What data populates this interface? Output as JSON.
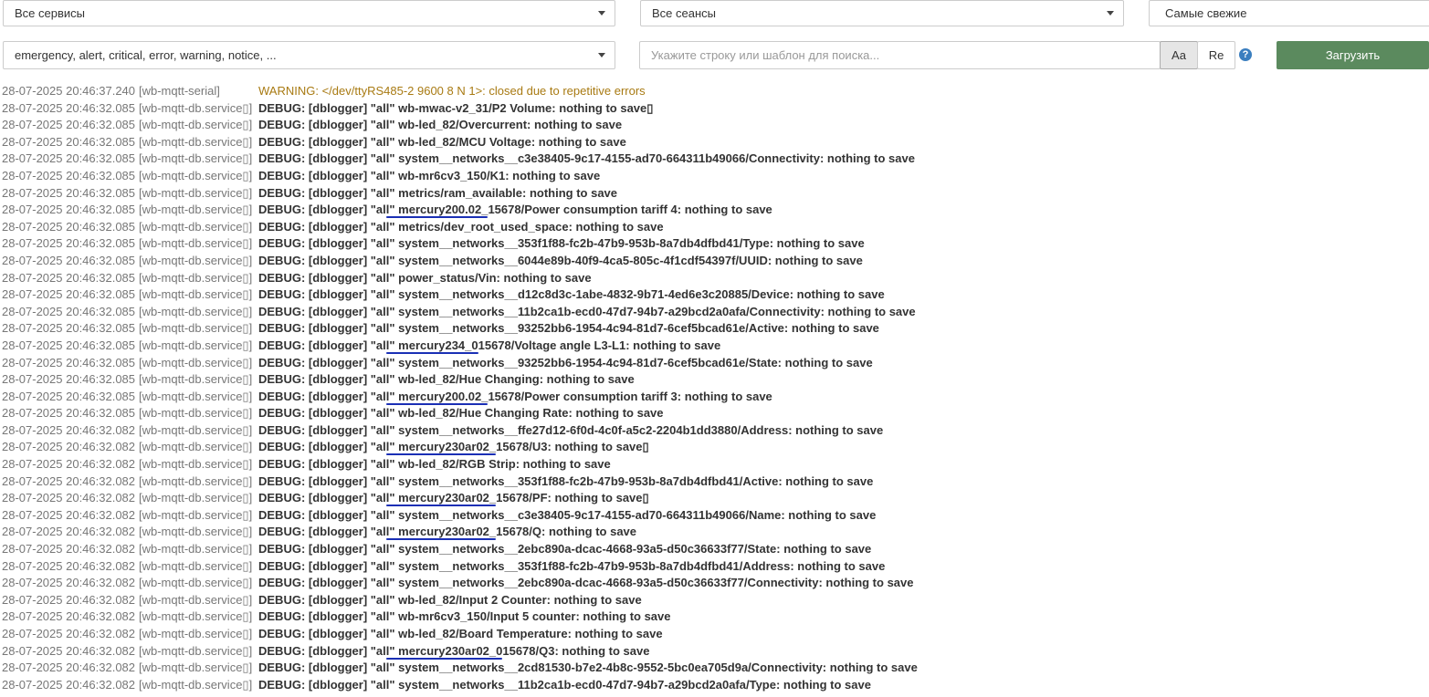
{
  "toolbar": {
    "services_select": "Все сервисы",
    "sessions_select": "Все сеансы",
    "order_select": "Самые свежие",
    "levels_select": "emergency, alert, critical, error, warning, notice, ...",
    "search_placeholder": "Укажите строку или шаблон для поиска...",
    "case_toggle": "Aa",
    "regex_toggle": "Re",
    "help_icon": "?",
    "load_button": "Загрузить"
  },
  "log_rows": [
    {
      "ts": "28-07-2025 20:46:37.240",
      "svc": "[wb-mqtt-serial]",
      "msg": "WARNING: </dev/ttyRS485-2 9600 8 N 1>: closed due to repetitive errors",
      "level": "warning"
    },
    {
      "ts": "28-07-2025 20:46:32.085",
      "svc": "[wb-mqtt-db.service▯]",
      "msg": "DEBUG: [dblogger] \"all\" wb-mwac-v2_31/P2 Volume: nothing to save▯",
      "level": "debug"
    },
    {
      "ts": "28-07-2025 20:46:32.085",
      "svc": "[wb-mqtt-db.service▯]",
      "msg": "DEBUG: [dblogger] \"all\" wb-led_82/Overcurrent: nothing to save",
      "level": "debug"
    },
    {
      "ts": "28-07-2025 20:46:32.085",
      "svc": "[wb-mqtt-db.service▯]",
      "msg": "DEBUG: [dblogger] \"all\" wb-led_82/MCU Voltage: nothing to save",
      "level": "debug"
    },
    {
      "ts": "28-07-2025 20:46:32.085",
      "svc": "[wb-mqtt-db.service▯]",
      "msg": "DEBUG: [dblogger] \"all\" system__networks__c3e38405-9c17-4155-ad70-664311b49066/Connectivity: nothing to save",
      "level": "debug"
    },
    {
      "ts": "28-07-2025 20:46:32.085",
      "svc": "[wb-mqtt-db.service▯]",
      "msg": "DEBUG: [dblogger] \"all\" wb-mr6cv3_150/K1: nothing to save",
      "level": "debug"
    },
    {
      "ts": "28-07-2025 20:46:32.085",
      "svc": "[wb-mqtt-db.service▯]",
      "msg": "DEBUG: [dblogger] \"all\" metrics/ram_available: nothing to save",
      "level": "debug"
    },
    {
      "ts": "28-07-2025 20:46:32.085",
      "svc": "[wb-mqtt-db.service▯]",
      "msg": "DEBUG: [dblogger] \"all\" mercury200.02_15678/Power consumption tariff 4: nothing to save",
      "level": "debug",
      "underline": true
    },
    {
      "ts": "28-07-2025 20:46:32.085",
      "svc": "[wb-mqtt-db.service▯]",
      "msg": "DEBUG: [dblogger] \"all\" metrics/dev_root_used_space: nothing to save",
      "level": "debug"
    },
    {
      "ts": "28-07-2025 20:46:32.085",
      "svc": "[wb-mqtt-db.service▯]",
      "msg": "DEBUG: [dblogger] \"all\" system__networks__353f1f88-fc2b-47b9-953b-8a7db4dfbd41/Type: nothing to save",
      "level": "debug"
    },
    {
      "ts": "28-07-2025 20:46:32.085",
      "svc": "[wb-mqtt-db.service▯]",
      "msg": "DEBUG: [dblogger] \"all\" system__networks__6044e89b-40f9-4ca5-805c-4f1cdf54397f/UUID: nothing to save",
      "level": "debug"
    },
    {
      "ts": "28-07-2025 20:46:32.085",
      "svc": "[wb-mqtt-db.service▯]",
      "msg": "DEBUG: [dblogger] \"all\" power_status/Vin: nothing to save",
      "level": "debug"
    },
    {
      "ts": "28-07-2025 20:46:32.085",
      "svc": "[wb-mqtt-db.service▯]",
      "msg": "DEBUG: [dblogger] \"all\" system__networks__d12c8d3c-1abe-4832-9b71-4ed6e3c20885/Device: nothing to save",
      "level": "debug"
    },
    {
      "ts": "28-07-2025 20:46:32.085",
      "svc": "[wb-mqtt-db.service▯]",
      "msg": "DEBUG: [dblogger] \"all\" system__networks__11b2ca1b-ecd0-47d7-94b7-a29bcd2a0afa/Connectivity: nothing to save",
      "level": "debug"
    },
    {
      "ts": "28-07-2025 20:46:32.085",
      "svc": "[wb-mqtt-db.service▯]",
      "msg": "DEBUG: [dblogger] \"all\" system__networks__93252bb6-1954-4c94-81d7-6cef5bcad61e/Active: nothing to save",
      "level": "debug"
    },
    {
      "ts": "28-07-2025 20:46:32.085",
      "svc": "[wb-mqtt-db.service▯]",
      "msg": "DEBUG: [dblogger] \"all\" mercury234_015678/Voltage angle L3-L1: nothing to save",
      "level": "debug",
      "underline": true
    },
    {
      "ts": "28-07-2025 20:46:32.085",
      "svc": "[wb-mqtt-db.service▯]",
      "msg": "DEBUG: [dblogger] \"all\" system__networks__93252bb6-1954-4c94-81d7-6cef5bcad61e/State: nothing to save",
      "level": "debug"
    },
    {
      "ts": "28-07-2025 20:46:32.085",
      "svc": "[wb-mqtt-db.service▯]",
      "msg": "DEBUG: [dblogger] \"all\" wb-led_82/Hue Changing: nothing to save",
      "level": "debug"
    },
    {
      "ts": "28-07-2025 20:46:32.085",
      "svc": "[wb-mqtt-db.service▯]",
      "msg": "DEBUG: [dblogger] \"all\" mercury200.02_15678/Power consumption tariff 3: nothing to save",
      "level": "debug",
      "underline": true
    },
    {
      "ts": "28-07-2025 20:46:32.085",
      "svc": "[wb-mqtt-db.service▯]",
      "msg": "DEBUG: [dblogger] \"all\" wb-led_82/Hue Changing Rate: nothing to save",
      "level": "debug"
    },
    {
      "ts": "28-07-2025 20:46:32.082",
      "svc": "[wb-mqtt-db.service▯]",
      "msg": "DEBUG: [dblogger] \"all\" system__networks__ffe27d12-6f0d-4c0f-a5c2-2204b1dd3880/Address: nothing to save",
      "level": "debug"
    },
    {
      "ts": "28-07-2025 20:46:32.082",
      "svc": "[wb-mqtt-db.service▯]",
      "msg": "DEBUG: [dblogger] \"all\" mercury230ar02_15678/U3: nothing to save▯",
      "level": "debug",
      "underline": true
    },
    {
      "ts": "28-07-2025 20:46:32.082",
      "svc": "[wb-mqtt-db.service▯]",
      "msg": "DEBUG: [dblogger] \"all\" wb-led_82/RGB Strip: nothing to save",
      "level": "debug"
    },
    {
      "ts": "28-07-2025 20:46:32.082",
      "svc": "[wb-mqtt-db.service▯]",
      "msg": "DEBUG: [dblogger] \"all\" system__networks__353f1f88-fc2b-47b9-953b-8a7db4dfbd41/Active: nothing to save",
      "level": "debug"
    },
    {
      "ts": "28-07-2025 20:46:32.082",
      "svc": "[wb-mqtt-db.service▯]",
      "msg": "DEBUG: [dblogger] \"all\" mercury230ar02_15678/PF: nothing to save▯",
      "level": "debug",
      "underline": true
    },
    {
      "ts": "28-07-2025 20:46:32.082",
      "svc": "[wb-mqtt-db.service▯]",
      "msg": "DEBUG: [dblogger] \"all\" system__networks__c3e38405-9c17-4155-ad70-664311b49066/Name: nothing to save",
      "level": "debug"
    },
    {
      "ts": "28-07-2025 20:46:32.082",
      "svc": "[wb-mqtt-db.service▯]",
      "msg": "DEBUG: [dblogger] \"all\" mercury230ar02_15678/Q: nothing to save",
      "level": "debug",
      "underline": true
    },
    {
      "ts": "28-07-2025 20:46:32.082",
      "svc": "[wb-mqtt-db.service▯]",
      "msg": "DEBUG: [dblogger] \"all\" system__networks__2ebc890a-dcac-4668-93a5-d50c36633f77/State: nothing to save",
      "level": "debug"
    },
    {
      "ts": "28-07-2025 20:46:32.082",
      "svc": "[wb-mqtt-db.service▯]",
      "msg": "DEBUG: [dblogger] \"all\" system__networks__353f1f88-fc2b-47b9-953b-8a7db4dfbd41/Address: nothing to save",
      "level": "debug"
    },
    {
      "ts": "28-07-2025 20:46:32.082",
      "svc": "[wb-mqtt-db.service▯]",
      "msg": "DEBUG: [dblogger] \"all\" system__networks__2ebc890a-dcac-4668-93a5-d50c36633f77/Connectivity: nothing to save",
      "level": "debug"
    },
    {
      "ts": "28-07-2025 20:46:32.082",
      "svc": "[wb-mqtt-db.service▯]",
      "msg": "DEBUG: [dblogger] \"all\" wb-led_82/Input 2 Counter: nothing to save",
      "level": "debug"
    },
    {
      "ts": "28-07-2025 20:46:32.082",
      "svc": "[wb-mqtt-db.service▯]",
      "msg": "DEBUG: [dblogger] \"all\" wb-mr6cv3_150/Input 5 counter: nothing to save",
      "level": "debug"
    },
    {
      "ts": "28-07-2025 20:46:32.082",
      "svc": "[wb-mqtt-db.service▯]",
      "msg": "DEBUG: [dblogger] \"all\" wb-led_82/Board Temperature: nothing to save",
      "level": "debug"
    },
    {
      "ts": "28-07-2025 20:46:32.082",
      "svc": "[wb-mqtt-db.service▯]",
      "msg": "DEBUG: [dblogger] \"all\" mercury230ar02_015678/Q3: nothing to save",
      "level": "debug",
      "underline": true
    },
    {
      "ts": "28-07-2025 20:46:32.082",
      "svc": "[wb-mqtt-db.service▯]",
      "msg": "DEBUG: [dblogger] \"all\" system__networks__2cd81530-b7e2-4b8c-9552-5bc0ea705d9a/Connectivity: nothing to save",
      "level": "debug"
    },
    {
      "ts": "28-07-2025 20:46:32.082",
      "svc": "[wb-mqtt-db.service▯]",
      "msg": "DEBUG: [dblogger] \"all\" system__networks__11b2ca1b-ecd0-47d7-94b7-a29bcd2a0afa/Type: nothing to save",
      "level": "debug"
    }
  ]
}
